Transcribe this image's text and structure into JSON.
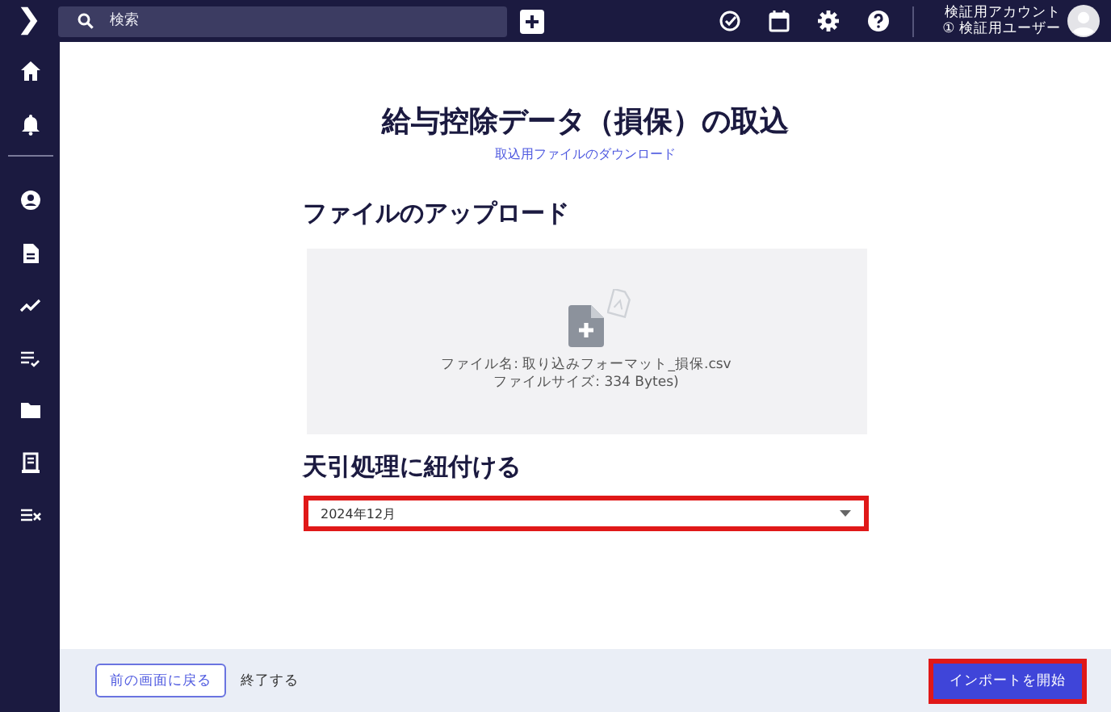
{
  "topbar": {
    "search": {
      "placeholder": "検索"
    },
    "account": {
      "name": "検証用アカウント",
      "user": "① 検証用ユーザー"
    }
  },
  "sidebar": {
    "items": [
      {
        "kind": "home"
      },
      {
        "kind": "bell"
      },
      {
        "kind": "divider"
      },
      {
        "kind": "user"
      },
      {
        "kind": "doc"
      },
      {
        "kind": "trend"
      },
      {
        "kind": "listcheck"
      },
      {
        "kind": "folder"
      },
      {
        "kind": "receipt"
      },
      {
        "kind": "listx"
      }
    ]
  },
  "page": {
    "title": "給与控除データ（損保）の取込",
    "download_link": "取込用ファイルのダウンロード"
  },
  "upload": {
    "heading": "ファイルのアップロード",
    "file_name": "ファイル名: 取り込みフォーマット_損保.csv",
    "file_size": "ファイルサイズ: 334 Bytes)"
  },
  "link_section": {
    "heading": "天引処理に紐付ける",
    "select": {
      "value": "2024年12月",
      "highlighted": true
    }
  },
  "footer": {
    "back_button": "前の画面に戻る",
    "finish_link": "終了する",
    "import_button": {
      "label": "インポートを開始",
      "highlighted": true
    }
  }
}
